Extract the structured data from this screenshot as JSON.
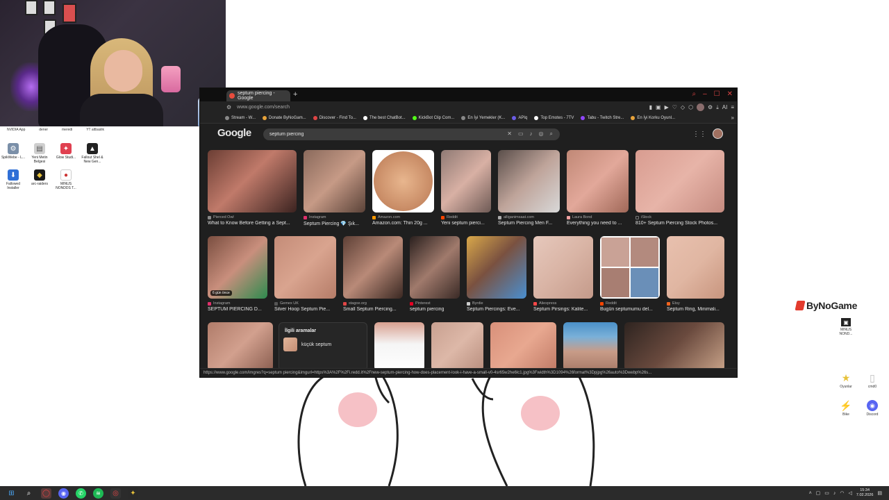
{
  "desktop": {
    "top_labels": [
      "NVIDIA App",
      "dener",
      "meredi",
      "YT altbaslik"
    ],
    "icons": [
      {
        "label": "SpikWebe - L...",
        "icon": "gear-icon",
        "color": "#7a8fa8"
      },
      {
        "label": "Yeni Metin Belgesi",
        "icon": "document-icon",
        "color": "#cfcfcf"
      },
      {
        "label": "Glow Studi...",
        "icon": "app-icon",
        "color": "#e04050"
      },
      {
        "label": "Fallout Shel & New Gen...",
        "icon": "game-icon",
        "color": "#222222"
      },
      {
        "label": "Fallowed Installer",
        "icon": "download-icon",
        "color": "#2f6fd6"
      },
      {
        "label": "arc-raiders",
        "icon": "game-icon",
        "color": "#1a1a1a"
      },
      {
        "label": "MINUS NONDDS T...",
        "icon": "app-icon",
        "color": "#ffffff"
      }
    ],
    "right_icons": [
      {
        "label": "MINUS NOND...",
        "icon": "app-icon"
      },
      {
        "label": "Oyunlar",
        "icon": "star-icon"
      },
      {
        "label": "cmd0",
        "icon": "document-icon"
      },
      {
        "label": "Bike",
        "icon": "bolt-icon"
      },
      {
        "label": "Discord",
        "icon": "discord-icon"
      }
    ],
    "brand_overlay": "ByNoGame"
  },
  "browser": {
    "tab_title": "septum piercing - Google",
    "url": "www.google.com/search",
    "bookmarks": [
      {
        "label": "Stream - W...",
        "color": "#888888"
      },
      {
        "label": "Donate ByNoGam...",
        "color": "#e8a33a"
      },
      {
        "label": "Discover - Find To...",
        "color": "#e04545"
      },
      {
        "label": "The best ChatBot...",
        "color": "#ffffff"
      },
      {
        "label": "KickBot Clip Com...",
        "color": "#53fc18"
      },
      {
        "label": "En İyi Yemekler (K...",
        "color": "#888888"
      },
      {
        "label": "APIq",
        "color": "#6b5ce7"
      },
      {
        "label": "Top Emotes - 7TV",
        "color": "#ffffff"
      },
      {
        "label": "Tabu - Twitch Stre...",
        "color": "#9146ff"
      },
      {
        "label": "En İyi Korku Oyunl...",
        "color": "#e8a33a"
      }
    ],
    "status_url": "https://www.google.com/imgres?q=septum piercing&imgurl=https%3A%2F%2Fi.redd.it%2Fnew-septum-piercing-how-does-placement-look-i-have-a-small-v0-4sr65w2he6lc1.jpg%3Fwidth%3D1094%26format%3Dpjpg%26auto%3Dwebp%26s..."
  },
  "google": {
    "logo": "Google",
    "query": "septum piercing",
    "results_row1": [
      {
        "source": "Pierced Owl",
        "caption": "What to Know Before Getting a Sept...",
        "color": "#c07a6a"
      },
      {
        "source": "Instagram",
        "caption": "Septum Piercing 💎 Şık...",
        "color": "#c69a86"
      },
      {
        "source": "Amazon.com",
        "caption": "Amazon.com: Thin 20g ...",
        "color": "#d7a07a"
      },
      {
        "source": "Reddit",
        "caption": "Yeni septum pierci...",
        "color": "#d8b0a4"
      },
      {
        "source": "alliganimsaat.com",
        "caption": "Septum Piercing Men F...",
        "color": "#bfa49a"
      },
      {
        "source": "Laura Bond",
        "caption": "Everything you need to ...",
        "color": "#e2a89a"
      },
      {
        "source": "iStock",
        "caption": "810+ Septum Piercing Stock Photos...",
        "color": "#e7b4a8"
      }
    ],
    "results_row2": [
      {
        "source": "Instagram",
        "caption": "SEPTUM PIERCING D...",
        "color": "#c98f7d",
        "badge": "6 gün önce"
      },
      {
        "source": "Gemex UK",
        "caption": "Silver Hoop Septum Pie...",
        "color": "#d9a48f",
        "badge": ""
      },
      {
        "source": "stagoe.org",
        "caption": "Small Septum Piercing...",
        "color": "#b98a78",
        "badge": ""
      },
      {
        "source": "Pinterest",
        "caption": "septum piercing",
        "color": "#a07a6c",
        "badge": ""
      },
      {
        "source": "Byrdie",
        "caption": "Septum Piercings: Eve...",
        "color": "#7a5140",
        "badge": ""
      },
      {
        "source": "Aliexpress",
        "caption": "Septum Pirsings: Kalite...",
        "color": "#d9b4a5",
        "badge": ""
      },
      {
        "source": "Reddit",
        "caption": "Bugün septumumu del...",
        "color": "#c9a296",
        "badge": ""
      },
      {
        "source": "Etsy",
        "caption": "Septum Ring, Minimali...",
        "color": "#e0b6a2",
        "badge": ""
      }
    ],
    "related": {
      "title": "İlgili aramalar",
      "items": [
        "küçük septum"
      ]
    }
  },
  "taskbar": {
    "time": "15:34",
    "date": "7.02.2026"
  }
}
